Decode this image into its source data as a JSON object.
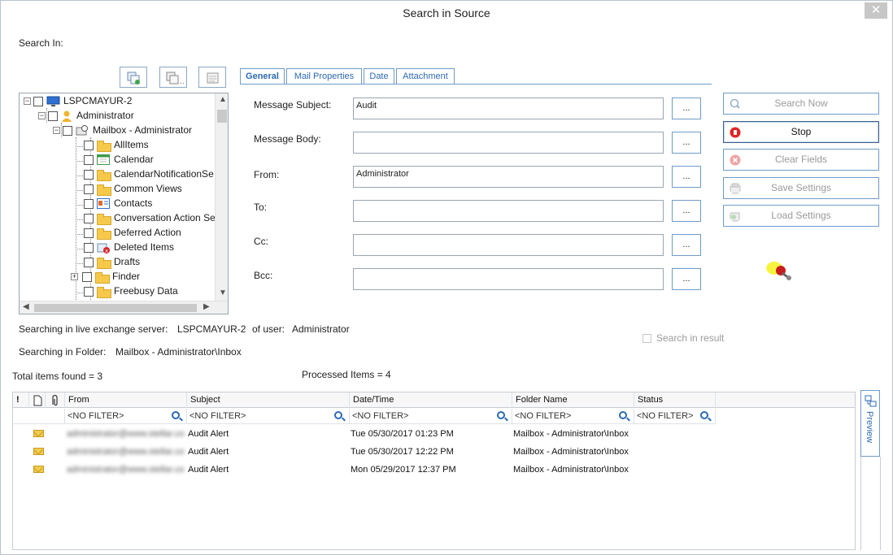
{
  "window": {
    "title": "Search in Source",
    "close_glyph": "✕"
  },
  "search_in_label": "Search In:",
  "tree": {
    "nodes": [
      {
        "label": "LSPCMAYUR-2",
        "icon": "computer-icon"
      },
      {
        "label": "Administrator",
        "icon": "user-icon"
      },
      {
        "label": "Mailbox - Administrator",
        "icon": "mailbox-icon"
      },
      {
        "label": "AllItems",
        "icon": "folder-icon"
      },
      {
        "label": "Calendar",
        "icon": "calendar-icon"
      },
      {
        "label": "CalendarNotificationSe",
        "icon": "folder-icon"
      },
      {
        "label": "Common Views",
        "icon": "folder-icon"
      },
      {
        "label": "Contacts",
        "icon": "contacts-icon"
      },
      {
        "label": "Conversation Action Se",
        "icon": "folder-icon"
      },
      {
        "label": "Deferred Action",
        "icon": "folder-icon"
      },
      {
        "label": "Deleted Items",
        "icon": "deleted-items-icon"
      },
      {
        "label": "Drafts",
        "icon": "folder-icon"
      },
      {
        "label": "Finder",
        "icon": "folder-icon"
      },
      {
        "label": "Freebusy Data",
        "icon": "folder-icon"
      }
    ]
  },
  "tabs": [
    "General",
    "Mail Properties",
    "Date",
    "Attachment"
  ],
  "fields": {
    "subject": {
      "label": "Message Subject:",
      "value": "Audit"
    },
    "body": {
      "label": "Message Body:",
      "value": ""
    },
    "from": {
      "label": "From:",
      "value": "Administrator"
    },
    "to": {
      "label": "To:",
      "value": ""
    },
    "cc": {
      "label": "Cc:",
      "value": ""
    },
    "bcc": {
      "label": "Bcc:",
      "value": ""
    }
  },
  "browse_label": "...",
  "actions": {
    "search_now": "Search Now",
    "stop": "Stop",
    "clear_fields": "Clear Fields",
    "save_settings": "Save Settings",
    "load_settings": "Load Settings"
  },
  "status": {
    "server_prefix": "Searching in live exchange server:",
    "server": "LSPCMAYUR-2",
    "user_prefix": "of user:",
    "user": "Administrator",
    "folder_prefix": "Searching in Folder:",
    "folder": "Mailbox - Administrator\\Inbox",
    "total": "Total items found = 3",
    "processed": "Processed Items = 4",
    "search_in_result": "Search in result"
  },
  "grid": {
    "columns": [
      "From",
      "Subject",
      "Date/Time",
      "Folder Name",
      "Status"
    ],
    "filter": "<NO FILTER>",
    "rows": [
      {
        "from": "administrator@www.stellar.com",
        "subject": "Audit Alert",
        "date": "Tue 05/30/2017 01:23 PM",
        "folder": "Mailbox - Administrator\\Inbox",
        "status": ""
      },
      {
        "from": "administrator@www.stellar.com",
        "subject": "Audit Alert",
        "date": "Tue 05/30/2017 12:22 PM",
        "folder": "Mailbox - Administrator\\Inbox",
        "status": ""
      },
      {
        "from": "administrator@www.stellar.com",
        "subject": "Audit Alert",
        "date": "Mon 05/29/2017 12:37 PM",
        "folder": "Mailbox - Administrator\\Inbox",
        "status": ""
      }
    ]
  },
  "preview_label": "Preview"
}
